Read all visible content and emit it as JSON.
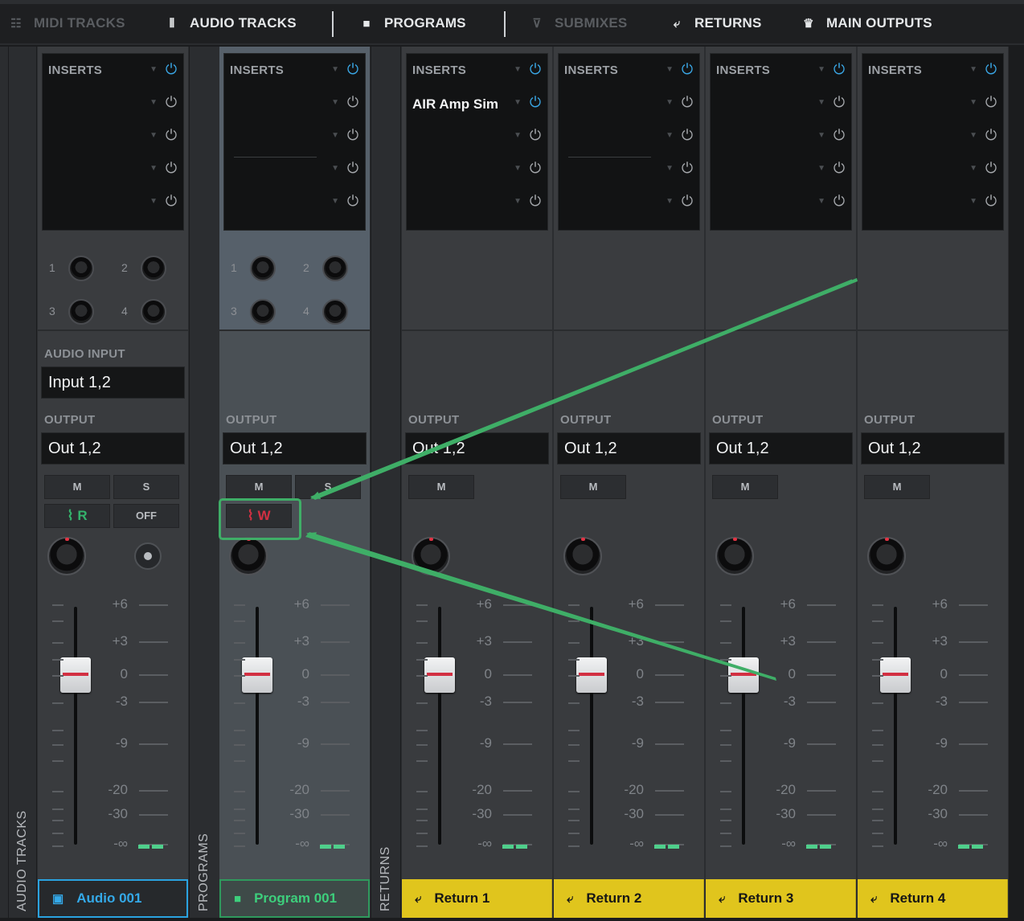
{
  "tabs": [
    {
      "label": "MIDI TRACKS",
      "icon": "grid-icon",
      "glyph": "☷",
      "dim": true
    },
    {
      "label": "AUDIO TRACKS",
      "icon": "waveform-icon",
      "glyph": "⫴",
      "dim": false
    },
    {
      "label": "PROGRAMS",
      "icon": "pads-icon",
      "glyph": "■",
      "dim": false
    },
    {
      "label": "SUBMIXES",
      "icon": "submix-icon",
      "glyph": "⊽",
      "dim": true
    },
    {
      "label": "RETURNS",
      "icon": "return-icon",
      "glyph": "⤶",
      "dim": false
    },
    {
      "label": "MAIN OUTPUTS",
      "icon": "crown-icon",
      "glyph": "♛",
      "dim": false
    }
  ],
  "groups": {
    "audio": "AUDIO TRACKS",
    "programs": "PROGRAMS",
    "returns": "RETURNS"
  },
  "labels": {
    "inserts": "INSERTS",
    "audio_input": "AUDIO INPUT",
    "output": "OUTPUT",
    "mute": "M",
    "solo": "S",
    "off": "OFF",
    "send_numbers": [
      "1",
      "2",
      "3",
      "4"
    ],
    "fader_scale": [
      "+6",
      "+3",
      "0",
      "-3",
      "-9",
      "-20",
      "-30",
      "-∞"
    ]
  },
  "channels": [
    {
      "name": "Audio 001",
      "kind": "audio",
      "icon": "audio-track-icon",
      "glyph": "▣",
      "inserts": [
        "",
        "",
        "",
        "",
        ""
      ],
      "input": "Input 1,2",
      "output": "Out 1,2",
      "automation": "R",
      "automation_state": "read",
      "solo": true,
      "sends": true,
      "selected": false
    },
    {
      "name": "Program 001",
      "kind": "program",
      "icon": "program-icon",
      "glyph": "■",
      "inserts": [
        "",
        "",
        "",
        "",
        ""
      ],
      "output": "Out 1,2",
      "automation": "W",
      "automation_state": "write",
      "solo": true,
      "sends": true,
      "selected": true
    },
    {
      "name": "Return 1",
      "kind": "return",
      "icon": "return-icon",
      "glyph": "⤶",
      "inserts": [
        "",
        "AIR Amp Sim",
        "",
        "",
        ""
      ],
      "output": "Out 1,2",
      "selected": false
    },
    {
      "name": "Return 2",
      "kind": "return",
      "icon": "return-icon",
      "glyph": "⤶",
      "inserts": [
        "",
        "",
        "",
        "",
        ""
      ],
      "output": "Out 1,2",
      "selected": false
    },
    {
      "name": "Return 3",
      "kind": "return",
      "icon": "return-icon",
      "glyph": "⤶",
      "inserts": [
        "",
        "",
        "",
        "",
        ""
      ],
      "output": "Out 1,2",
      "selected": false
    },
    {
      "name": "Return 4",
      "kind": "return",
      "icon": "return-icon",
      "glyph": "⤶",
      "inserts": [
        "",
        "",
        "",
        "",
        ""
      ],
      "output": "Out 1,2",
      "selected": false
    }
  ],
  "colors": {
    "accent_blue": "#2aa3e0",
    "program_green": "#3dcf7c",
    "return_yellow": "#e0c51d",
    "annotation_green": "#3fae67",
    "write_red": "#d03042"
  }
}
